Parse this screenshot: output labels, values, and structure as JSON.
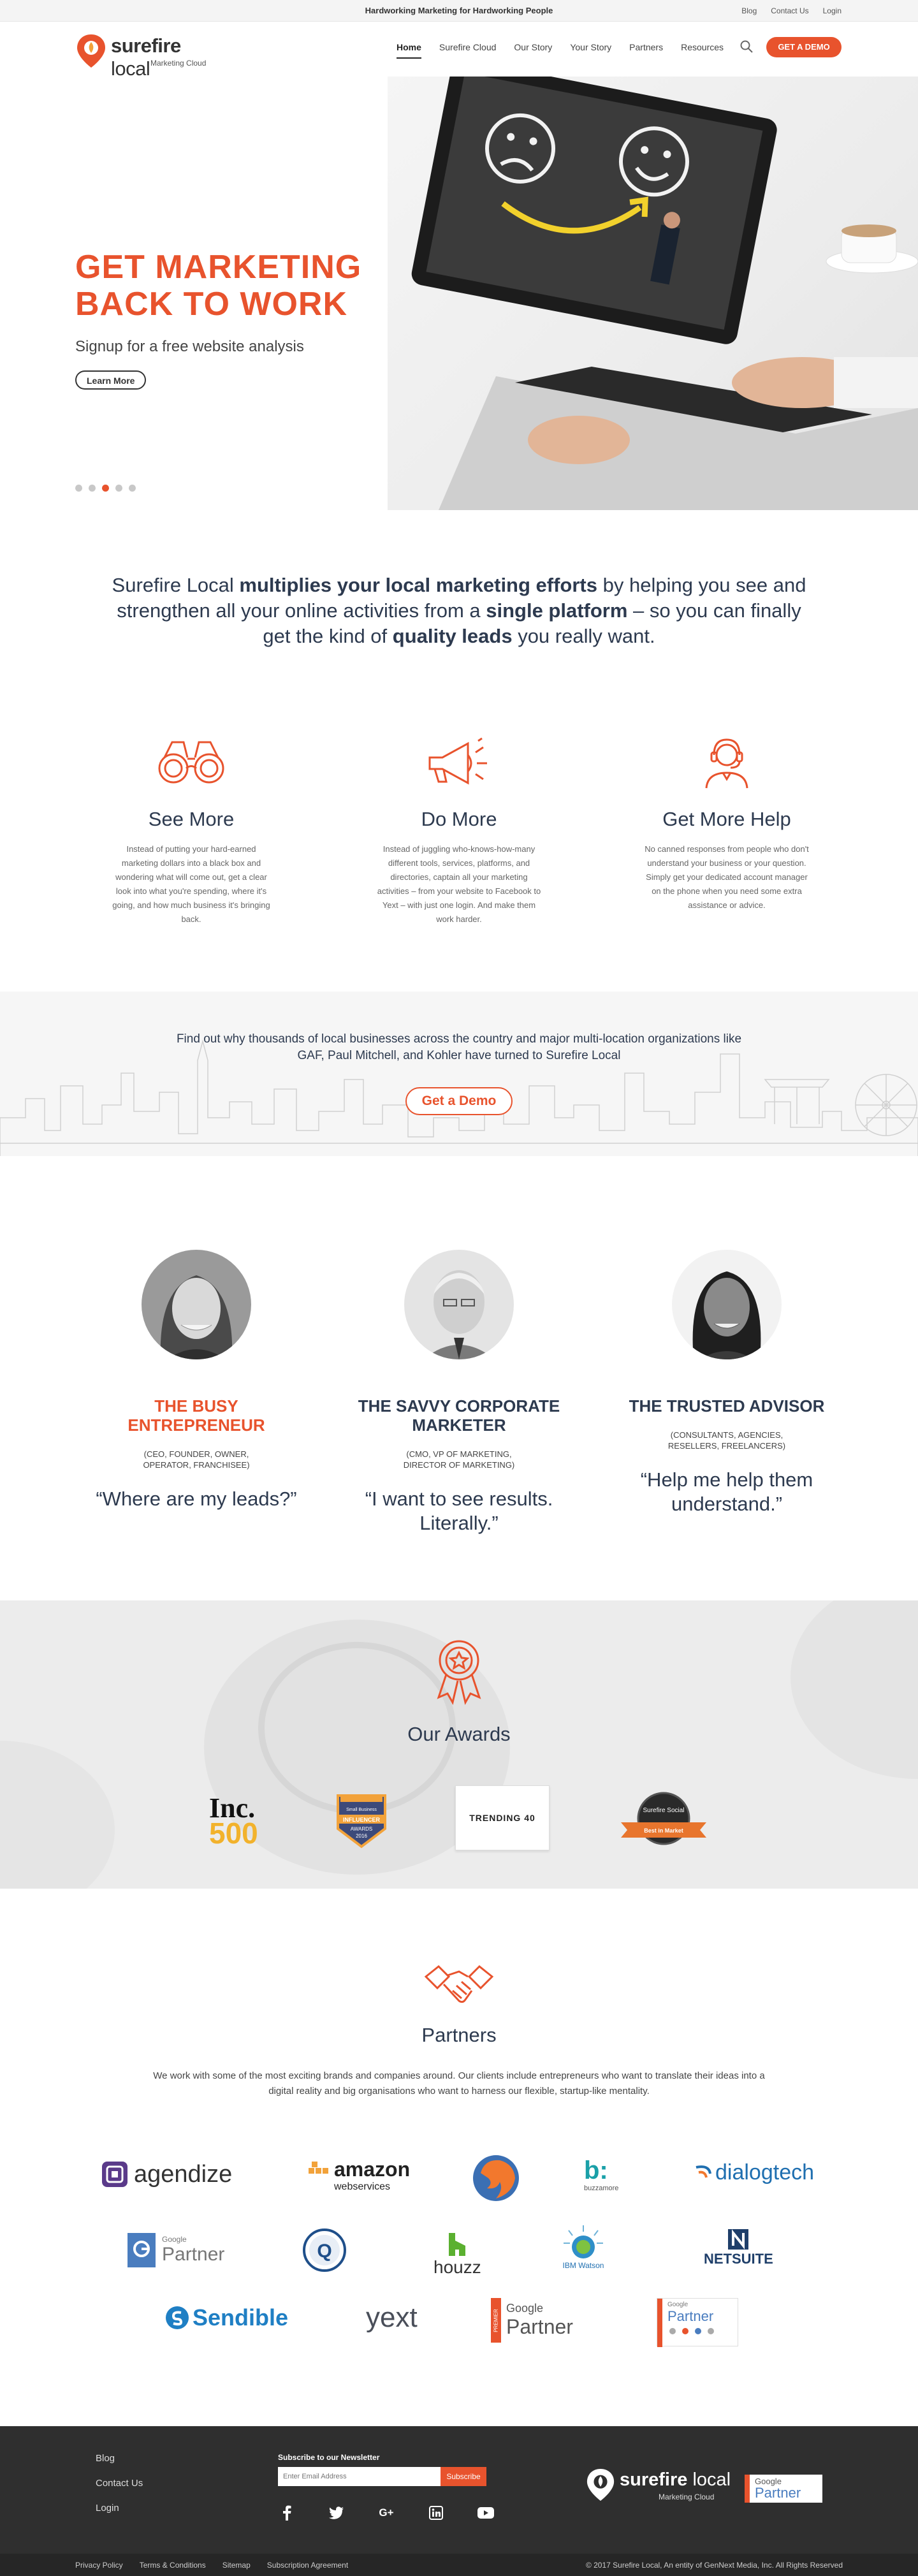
{
  "topbar": {
    "tagline": "Hardworking Marketing for Hardworking People",
    "links": [
      "Blog",
      "Contact Us",
      "Login"
    ]
  },
  "header": {
    "logo_brand": "surefire",
    "logo_brand_light": "local",
    "logo_sub": "Marketing Cloud",
    "nav": [
      "Home",
      "Surefire Cloud",
      "Our Story",
      "Your Story",
      "Partners",
      "Resources"
    ],
    "active_nav": "Home",
    "demo_button": "GET A DEMO"
  },
  "hero": {
    "title_line1": "GET MARKETING",
    "title_line2": "BACK TO WORK",
    "tagline": "Signup for a free website analysis",
    "button": "Learn More",
    "slides": 5,
    "active_slide": 3
  },
  "intro": {
    "p1": "Surefire Local ",
    "b1": "multiplies your local marketing efforts",
    "p2": " by helping you see and strengthen all your online activities from a ",
    "b2": "single platform",
    "p3": " – so you can finally get the kind of ",
    "b3": "quality leads",
    "p4": " you really want."
  },
  "features": [
    {
      "icon": "binoculars-icon",
      "title": "See More",
      "text": "Instead of putting your hard-earned marketing dollars into a black box and  wondering what will come out, get a clear  look into what you're spending, where it's  going, and how much business it's bringing back."
    },
    {
      "icon": "megaphone-icon",
      "title": "Do More",
      "text": "Instead of juggling who-knows-how-many different tools, services, platforms, and directories, captain all your marketing activities – from your website to Facebook to Yext – with just one login. And make them work harder."
    },
    {
      "icon": "support-agent-icon",
      "title": "Get More Help",
      "text": "No canned responses from people who  don't understand your business or your  question. Simply get your dedicated account manager on the phone when you need some extra assistance or advice."
    }
  ],
  "city": {
    "lead": "Find out why thousands of local businesses across the country and major multi-location organizations like GAF, Paul Mitchell, and Kohler have turned to Surefire Local",
    "cta": "Get a Demo"
  },
  "personas": [
    {
      "title": "THE BUSY ENTREPRENEUR",
      "roles": "(CEO, FOUNDER, OWNER, OPERATOR, FRANCHISEE)",
      "quote": "“Where are my leads?”"
    },
    {
      "title": "THE SAVVY CORPORATE MARKETER",
      "roles": "(CMO, VP OF MARKETING, DIRECTOR OF MARKETING)",
      "quote": "“I want to see results. Literally.”"
    },
    {
      "title": "THE TRUSTED ADVISOR",
      "roles": "(CONSULTANTS, AGENCIES, RESELLERS, FREELANCERS)",
      "quote": "“Help me help them understand.”"
    }
  ],
  "awards": {
    "title": "Our Awards",
    "inc_top": "Inc.",
    "inc_num": "500",
    "badge1_lines": [
      "Small Business",
      "INFLUENCER",
      "AWARDS",
      "2016"
    ],
    "trending": "TRENDING 40",
    "badge2_lines": [
      "Surefire Social",
      "Best in Market"
    ]
  },
  "partners": {
    "title": "Partners",
    "desc": "We work with some of the most exciting brands and companies around. Our clients include entrepreneurs who want to translate their ideas into a digital reality and big organisations who want to harness our flexible, startup-like mentality.",
    "logos": {
      "agendize": "agendize",
      "amazon": "amazon",
      "amazon_sub": "webservices",
      "buzz_b": "b:",
      "buzz": "buzzamore",
      "dialogtech": "dialogtech",
      "google": "Google",
      "partner": "Partner",
      "houzz": "houzz",
      "ibm": "IBM Watson",
      "netsuite": "NETSUITE",
      "sendible": "Sendible",
      "yext": "yext",
      "premier": "PREMIER"
    }
  },
  "footer": {
    "links": [
      "Blog",
      "Contact Us",
      "Login"
    ],
    "newsletter_title": "Subscribe to our Newsletter",
    "email_placeholder": "Enter Email Address",
    "subscribe": "Subscribe",
    "social": [
      "f",
      "t",
      "G+",
      "in",
      "yt"
    ],
    "logo_brand": "surefire",
    "logo_brand_light": "local",
    "logo_sub": "Marketing Cloud",
    "gp_google": "Google",
    "gp_partner": "Partner"
  },
  "bottombar": {
    "links": [
      "Privacy Policy",
      "Terms & Conditions",
      "Sitemap",
      "Subscription Agreement"
    ],
    "copyright": "© 2017  Surefire Local, An entity of GenNext Media, Inc.  All Rights Reserved"
  },
  "colors": {
    "accent": "#e8532d",
    "navy": "#2d3a4f",
    "footer": "#2f2f2f"
  }
}
